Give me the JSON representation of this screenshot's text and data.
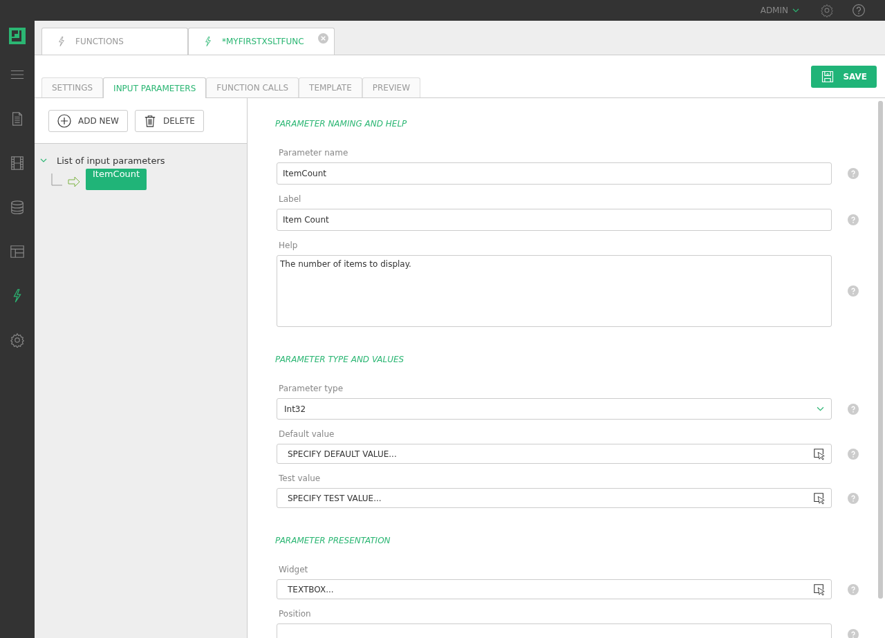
{
  "top_bar": {
    "user": "ADMIN"
  },
  "sidebar": {
    "items": [
      {
        "kind": "menu",
        "selected": false
      },
      {
        "kind": "document",
        "selected": false
      },
      {
        "kind": "film",
        "selected": false
      },
      {
        "kind": "database",
        "selected": false
      },
      {
        "kind": "layout",
        "selected": false
      },
      {
        "kind": "function",
        "selected": true
      },
      {
        "kind": "settings",
        "selected": false
      }
    ]
  },
  "document_tabs": [
    {
      "label": "FUNCTIONS",
      "selected": false,
      "closable": false
    },
    {
      "label": "*MYFIRSTXSLTFUNC",
      "selected": true,
      "closable": true
    }
  ],
  "save_button": "SAVE",
  "tabs": [
    {
      "label": "SETTINGS",
      "selected": false
    },
    {
      "label": "INPUT PARAMETERS",
      "selected": true
    },
    {
      "label": "FUNCTION CALLS",
      "selected": false
    },
    {
      "label": "TEMPLATE",
      "selected": false
    },
    {
      "label": "PREVIEW",
      "selected": false
    }
  ],
  "toolbar": [
    {
      "kind": "add",
      "label": "ADD NEW"
    },
    {
      "kind": "delete",
      "label": "DELETE"
    }
  ],
  "tree": [
    {
      "label": "List of input parameters",
      "expanded": true,
      "selected": false,
      "children": [
        {
          "label": "ItemCount",
          "selected": true
        }
      ]
    }
  ],
  "sections": [
    {
      "title": "PARAMETER NAMING AND HELP",
      "fields": [
        {
          "kind": "text",
          "label": "Parameter name",
          "value": "ItemCount",
          "help": true
        },
        {
          "kind": "text",
          "label": "Label",
          "value": "Item Count",
          "help": true
        },
        {
          "kind": "textarea",
          "label": "Help",
          "value": "The number of items to display.",
          "help": true
        }
      ]
    },
    {
      "title": "PARAMETER TYPE AND VALUES",
      "fields": [
        {
          "kind": "select",
          "label": "Parameter type",
          "value": "Int32",
          "help": true
        },
        {
          "kind": "picker",
          "label": "Default value",
          "value": "SPECIFY DEFAULT VALUE...",
          "help": true
        },
        {
          "kind": "picker",
          "label": "Test value",
          "value": "SPECIFY TEST VALUE...",
          "help": true
        }
      ]
    },
    {
      "title": "PARAMETER PRESENTATION",
      "fields": [
        {
          "kind": "picker",
          "label": "Widget",
          "value": "TEXTBOX...",
          "help": true
        },
        {
          "kind": "text",
          "label": "Position",
          "help": true
        }
      ]
    }
  ]
}
